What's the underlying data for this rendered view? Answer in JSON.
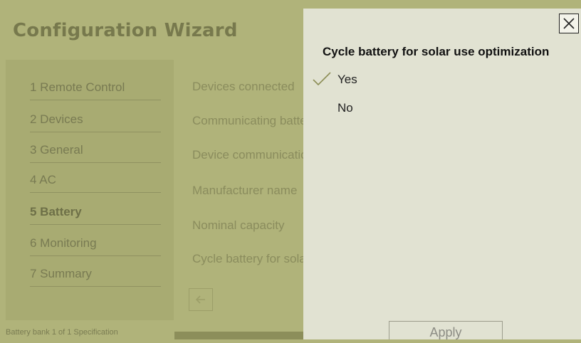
{
  "wizard": {
    "title": "Configuration Wizard",
    "steps": [
      {
        "label": "1 Remote Control",
        "active": false
      },
      {
        "label": "2 Devices",
        "active": false
      },
      {
        "label": "3 General",
        "active": false
      },
      {
        "label": "4 AC",
        "active": false
      },
      {
        "label": "5 Battery",
        "active": true
      },
      {
        "label": "6 Monitoring",
        "active": false
      },
      {
        "label": "7 Summary",
        "active": false
      }
    ],
    "settings": [
      "Devices connected",
      "Communicating battery",
      "Device communication",
      "Manufacturer name",
      "Nominal capacity",
      "Cycle battery for solar"
    ],
    "back_icon": "arrow-left-icon",
    "battery_spec": "Battery bank 1 of 1 Specification"
  },
  "popup": {
    "title": "Cycle battery for solar use optimization",
    "options": [
      {
        "label": "Yes",
        "selected": true
      },
      {
        "label": "No",
        "selected": false
      }
    ],
    "apply_label": "Apply",
    "close_icon": "close-icon",
    "check_icon": "checkmark-icon"
  },
  "colors": {
    "dim_background": "#b0b37a",
    "popup_background": "#e1e2d2",
    "check": "#8c8e56"
  }
}
